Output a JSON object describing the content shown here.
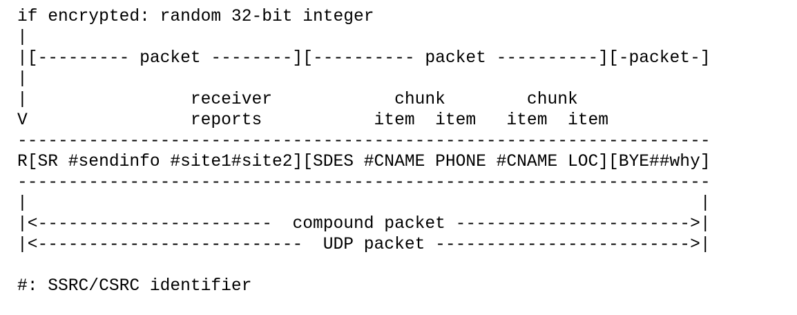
{
  "diagram": {
    "lines": [
      "if encrypted: random 32-bit integer",
      "|",
      "|[--------- packet --------][---------- packet ----------][-packet-]",
      "|",
      "|                receiver            chunk        chunk",
      "V                reports           item  item   item  item",
      "--------------------------------------------------------------------",
      "R[SR #sendinfo #site1#site2][SDES #CNAME PHONE #CNAME LOC][BYE##why]",
      "--------------------------------------------------------------------",
      "|                                                                  |",
      "|<-----------------------  compound packet ----------------------->|",
      "|<--------------------------  UDP packet ------------------------->|",
      "",
      "#: SSRC/CSRC identifier"
    ]
  }
}
